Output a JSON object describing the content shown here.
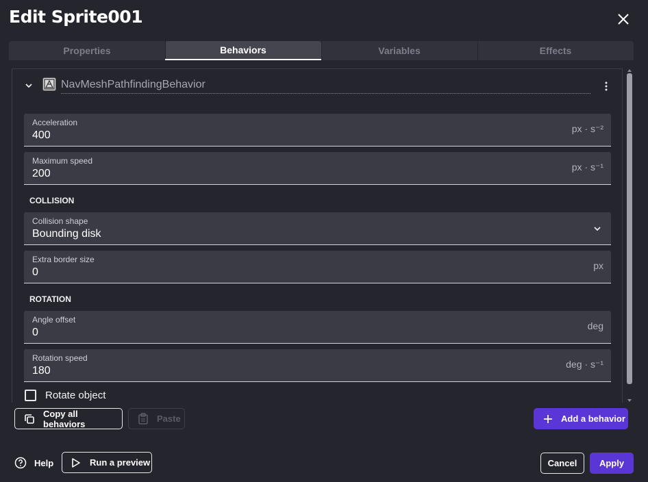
{
  "dialog": {
    "title": "Edit Sprite001",
    "close_icon": "close-icon"
  },
  "tabs": [
    {
      "label": "Properties",
      "active": false
    },
    {
      "label": "Behaviors",
      "active": true
    },
    {
      "label": "Variables",
      "active": false
    },
    {
      "label": "Effects",
      "active": false
    }
  ],
  "behavior": {
    "name": "NavMeshPathfindingBehavior",
    "icon": "navmesh-behavior-icon",
    "fields": {
      "acceleration": {
        "label": "Acceleration",
        "value": "400",
        "unit": "px · s⁻²"
      },
      "max_speed": {
        "label": "Maximum speed",
        "value": "200",
        "unit": "px · s⁻¹"
      },
      "collision_shape": {
        "label": "Collision shape",
        "value": "Bounding disk"
      },
      "extra_border": {
        "label": "Extra border size",
        "value": "0",
        "unit": "px"
      },
      "angle_offset": {
        "label": "Angle offset",
        "value": "0",
        "unit": "deg"
      },
      "rotation_speed": {
        "label": "Rotation speed",
        "value": "180",
        "unit": "deg · s⁻¹"
      }
    },
    "sections": {
      "collision": "COLLISION",
      "rotation": "ROTATION"
    },
    "rotate_object": {
      "label": "Rotate object",
      "checked": false
    }
  },
  "actions": {
    "copy_all": "Copy all behaviors",
    "paste": "Paste",
    "add_behavior": "Add a behavior"
  },
  "footer": {
    "help": "Help",
    "run_preview": "Run a preview",
    "cancel": "Cancel",
    "apply": "Apply"
  },
  "colors": {
    "background": "#25252e",
    "field_bg": "#3b3b45",
    "primary": "#5b36d6"
  }
}
